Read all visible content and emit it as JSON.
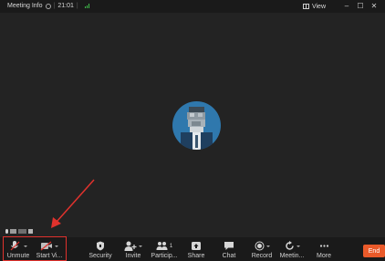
{
  "titlebar": {
    "meeting_info": "Meeting Info",
    "timer": "21:01",
    "view_label": "View",
    "minimize": "–",
    "maximize": "☐",
    "close": "✕"
  },
  "toolbar": {
    "unmute": "Unmute",
    "start_video": "Start Vi...",
    "security": "Security",
    "invite": "Invite",
    "participants": "Particip...",
    "share": "Share",
    "chat": "Chat",
    "record": "Record",
    "meeting": "Meetin...",
    "more": "More",
    "participant_count": "1",
    "end": "End"
  },
  "icons": {
    "info": "info-icon",
    "signal": "signal-icon",
    "view": "grid-view-icon",
    "unmute": "muted-mic-icon",
    "start_video": "video-off-icon",
    "security": "shield-icon",
    "invite": "add-person-icon",
    "participants": "people-icon",
    "share": "share-screen-icon",
    "chat": "chat-bubble-icon",
    "record": "record-icon",
    "meeting": "refresh-icon",
    "more": "more-dots-icon"
  },
  "colors": {
    "background": "#232323",
    "bar": "#1a1a1a",
    "avatar_bg": "#2f78ad",
    "end_button": "#ea5a2a",
    "annotation": "#e0322d",
    "signal": "#3fbf4a"
  }
}
